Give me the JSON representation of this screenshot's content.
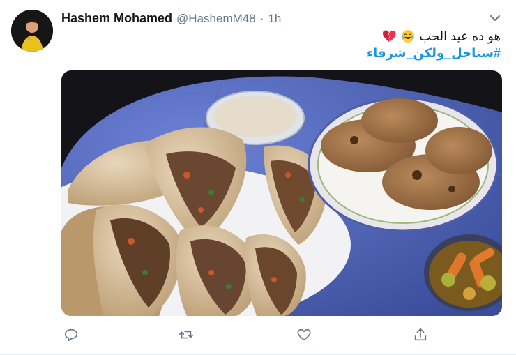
{
  "tweet": {
    "author_name": "Hashem Mohamed",
    "author_handle": "@HashemM48",
    "separator": "·",
    "time": "1h",
    "text_line1": "هو ده عيد الحب",
    "hashtag": "#سناجل_ولكن_شرفاء",
    "emojis": [
      "face-with-tears-of-joy",
      "broken-heart"
    ]
  },
  "icons": {
    "more": "chevron-down-icon",
    "reply": "reply-icon",
    "retweet": "retweet-icon",
    "like": "heart-icon",
    "share": "share-icon"
  },
  "colors": {
    "link": "#1b95e0",
    "muted": "#657786",
    "table": "#4a5fb0"
  }
}
